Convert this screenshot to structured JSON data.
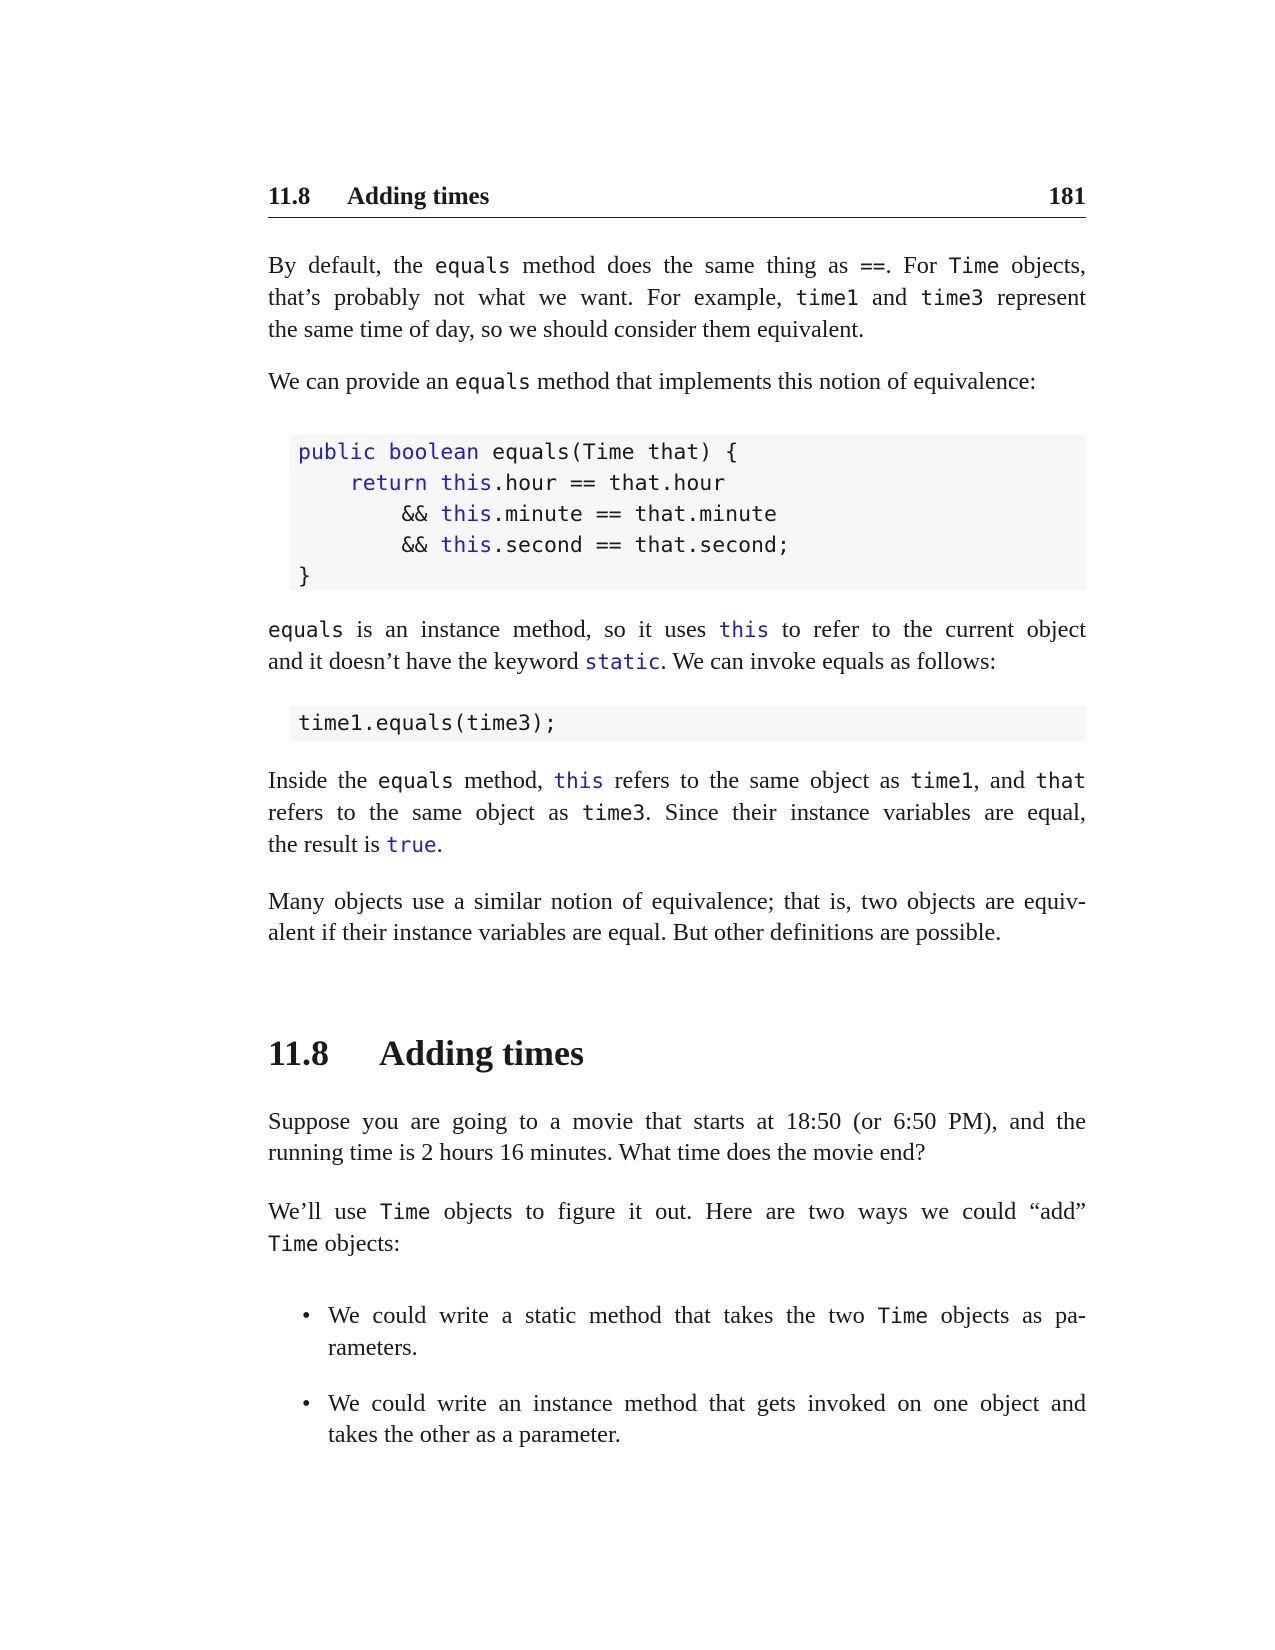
{
  "header": {
    "section_number": "11.8",
    "section_title": "Adding times",
    "page_number": "181"
  },
  "p1": {
    "l1": {
      "a": "By default, the ",
      "b": "equals",
      "c": " method does the same thing as ",
      "d": "==",
      "e": ". For ",
      "f": "Time",
      "g": " objects,"
    },
    "l2": {
      "a": "that’s probably not what we want. For example, ",
      "b": "time1",
      "c": " and ",
      "d": "time3",
      "e": " represent"
    },
    "l3": "the same time of day, so we should consider them equivalent."
  },
  "p2": {
    "a": "We can provide an ",
    "b": "equals",
    "c": " method that implements this notion of equivalence:"
  },
  "code1": {
    "l1": {
      "kw1": "public",
      "kw2": "boolean",
      "rest": " equals(Time that) {"
    },
    "l2": {
      "indent": "    ",
      "kw1": "return",
      "kw2": "this",
      "rest": ".hour == that.hour"
    },
    "l3": {
      "indent": "        && ",
      "kw": "this",
      "rest": ".minute == that.minute"
    },
    "l4": {
      "indent": "        && ",
      "kw": "this",
      "rest": ".second == that.second;"
    },
    "l5": "}"
  },
  "p3": {
    "l1": {
      "a": "equals",
      "b": " is an instance method, so it uses ",
      "c": "this",
      "d": " to refer to the current object"
    },
    "l2": {
      "a": "and it doesn’t have the keyword ",
      "b": "static",
      "c": ". We can invoke equals as follows:"
    }
  },
  "code2": "time1.equals(time3);",
  "p4": {
    "l1": {
      "a": "Inside the ",
      "b": "equals",
      "c": " method, ",
      "d": "this",
      "e": " refers to the same object as ",
      "f": "time1",
      "g": ", and ",
      "h": "that"
    },
    "l2": {
      "a": "refers to the same object as ",
      "b": "time3",
      "c": ". Since their instance variables are equal,"
    },
    "l3": {
      "a": "the result is ",
      "b": "true",
      "c": "."
    }
  },
  "p5": {
    "l1": "Many objects use a similar notion of equivalence; that is, two objects are equiv-",
    "l2": "alent if their instance variables are equal. But other definitions are possible."
  },
  "section": {
    "number": "11.8",
    "title": "Adding times"
  },
  "p6": {
    "l1": "Suppose you are going to a movie that starts at 18:50 (or 6:50 PM), and the",
    "l2": "running time is 2 hours 16 minutes. What time does the movie end?"
  },
  "p7": {
    "l1": {
      "a": "We’ll use ",
      "b": "Time",
      "c": " objects to figure it out. Here are two ways we could “add”"
    },
    "l2": {
      "a": "Time",
      "b": " objects:"
    }
  },
  "bullets": {
    "b1": {
      "l1a": "We could write a static method that takes the two ",
      "l1b": "Time",
      "l1c": " objects as pa-",
      "l2": "rameters."
    },
    "b2": {
      "l1": "We could write an instance method that gets invoked on one object and",
      "l2": "takes the other as a parameter."
    }
  },
  "bullet_symbol": "•"
}
